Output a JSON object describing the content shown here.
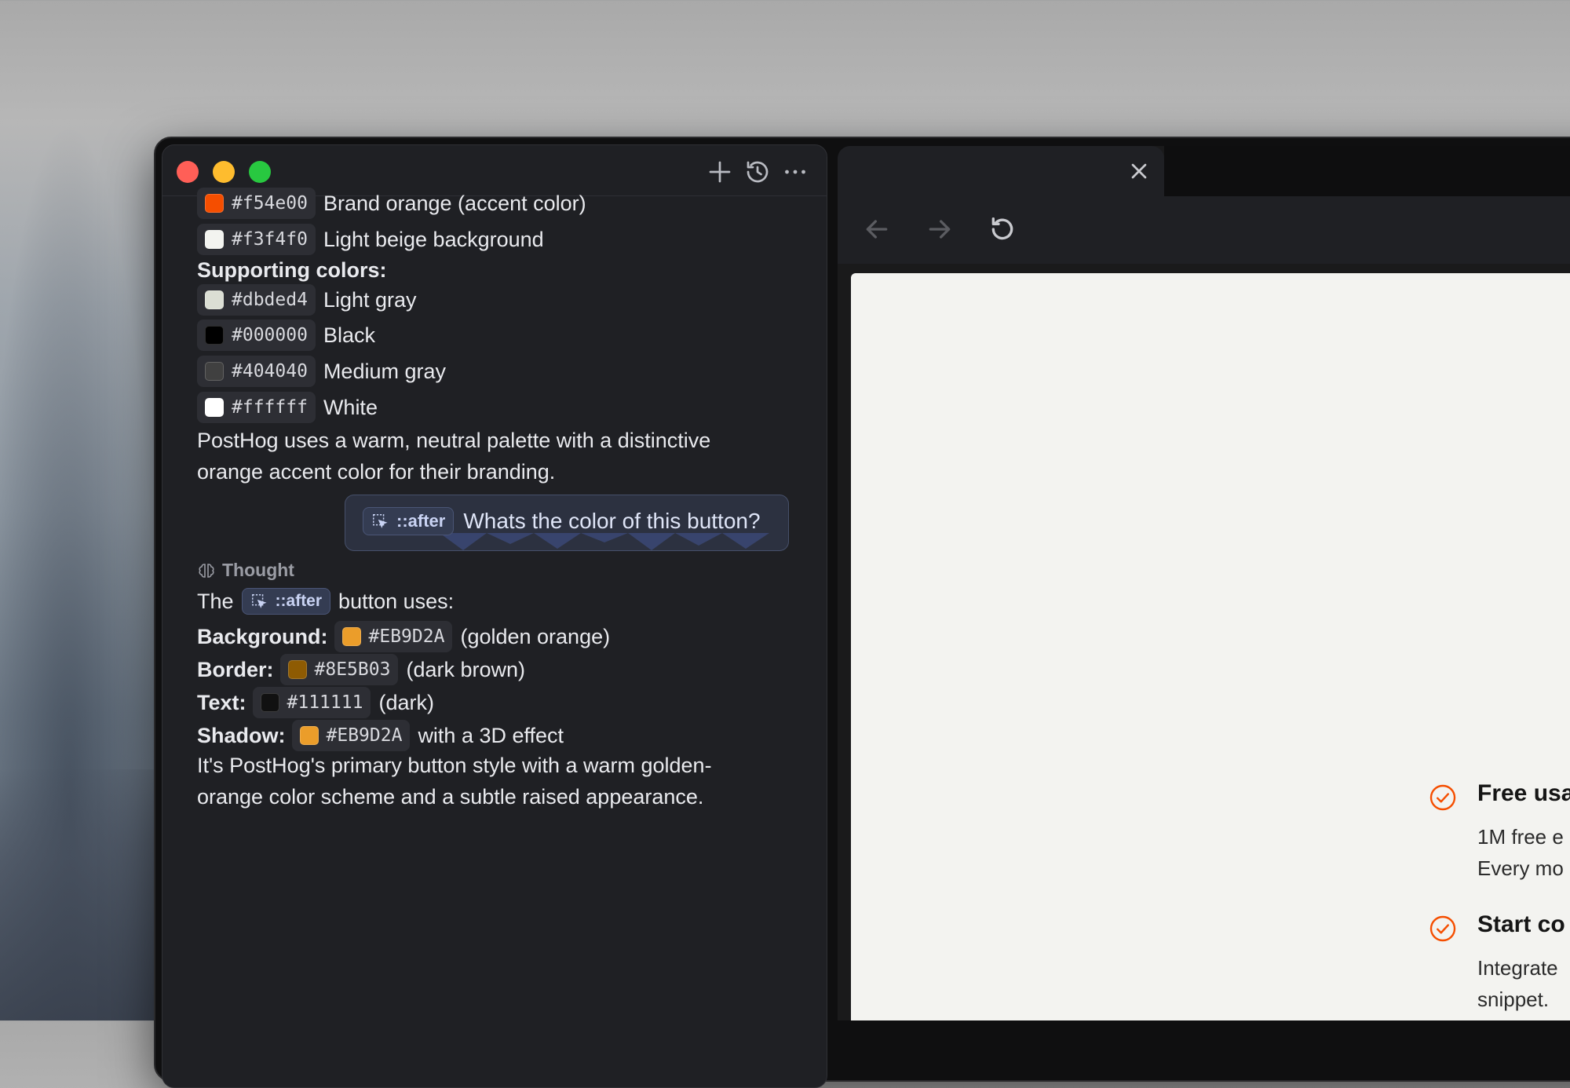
{
  "titlebar": {
    "buttons": [
      "plus-icon",
      "history-icon",
      "more-icon"
    ]
  },
  "colors": {
    "primary": [
      {
        "hex": "#f54e00",
        "swatch": "#f54e00",
        "label": "Brand orange (accent color)"
      },
      {
        "hex": "#f3f4f0",
        "swatch": "#f3f4f0",
        "label": "Light beige background"
      }
    ],
    "supporting_heading": "Supporting colors:",
    "supporting": [
      {
        "hex": "#dbded4",
        "swatch": "#dbded4",
        "label": "Light gray"
      },
      {
        "hex": "#000000",
        "swatch": "#000000",
        "label": "Black"
      },
      {
        "hex": "#404040",
        "swatch": "#404040",
        "label": "Medium gray"
      },
      {
        "hex": "#ffffff",
        "swatch": "#ffffff",
        "label": "White"
      }
    ],
    "summary_line1": "PostHog uses a warm, neutral palette with a distinctive",
    "summary_line2": "orange accent color for their branding."
  },
  "user_message": {
    "element_chip": "::after",
    "text": "Whats the color of this button?"
  },
  "thought_label": "Thought",
  "answer": {
    "intro_prefix": "The",
    "element_chip": "::after",
    "intro_suffix": "button uses:",
    "items": [
      {
        "key": "Background:",
        "hex": "#EB9D2A",
        "swatch": "#EB9D2A",
        "note": "(golden orange)"
      },
      {
        "key": "Border:",
        "hex": "#8E5B03",
        "swatch": "#8E5B03",
        "note": "(dark brown)"
      },
      {
        "key": "Text:",
        "hex": "#111111",
        "swatch": "#111111",
        "note": "(dark)"
      },
      {
        "key": "Shadow:",
        "hex": "#EB9D2A",
        "swatch": "#EB9D2A",
        "note": "with a 3D effect"
      }
    ],
    "conclusion_line1": "It's PostHog's primary button style with a warm golden-",
    "conclusion_line2": "orange color scheme and a subtle raised appearance."
  },
  "browser": {
    "tab_close": "close-icon",
    "nav": [
      "back-arrow-icon",
      "forward-arrow-icon",
      "reload-icon"
    ],
    "features": [
      {
        "title": "Free usa",
        "line1": "1M free e",
        "line2": "Every mo"
      },
      {
        "title": "Start co",
        "line1": "Integrate",
        "line2": "snippet."
      }
    ],
    "accent": "#f54e00"
  }
}
